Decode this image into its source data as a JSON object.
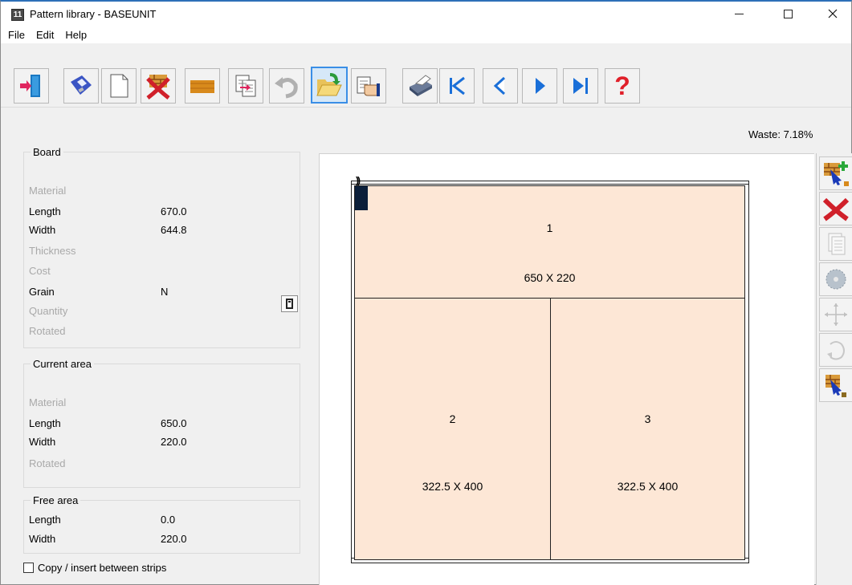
{
  "window": {
    "title": "Pattern library - BASEUNIT",
    "app_icon_text": "11"
  },
  "menu": [
    "File",
    "Edit",
    "Help"
  ],
  "toolbar": {
    "buttons": [
      "exit-icon",
      "save-icon",
      "new-page-icon",
      "delete-pattern-icon",
      "board-icon",
      "copy-pattern-icon",
      "undo-icon",
      "open-folder-icon",
      "hand-pointer-icon",
      "print-icon",
      "first-record-icon",
      "previous-record-icon",
      "next-record-icon",
      "last-record-icon",
      "help-icon"
    ]
  },
  "waste": "Waste: 7.18%",
  "board": {
    "title": "Board",
    "material_label": "Material",
    "length_label": "Length",
    "length_value": "670.0",
    "width_label": "Width",
    "width_value": "644.8",
    "thickness_label": "Thickness",
    "cost_label": "Cost",
    "grain_label": "Grain",
    "grain_value": "N",
    "quantity_label": "Quantity",
    "rotated_label": "Rotated"
  },
  "current_area": {
    "title": "Current area",
    "material_label": "Material",
    "length_label": "Length",
    "length_value": "650.0",
    "width_label": "Width",
    "width_value": "220.0",
    "rotated_label": "Rotated"
  },
  "free_area": {
    "title": "Free area",
    "length_label": "Length",
    "length_value": "0.0",
    "width_label": "Width",
    "width_value": "220.0"
  },
  "copy_insert_label": "Copy / insert between strips",
  "grain_marker": "))",
  "parts": [
    {
      "num": "1",
      "dims": "650 X 220"
    },
    {
      "num": "2",
      "dims": "322.5 X 400"
    },
    {
      "num": "3",
      "dims": "322.5 X 400"
    }
  ],
  "colors": {
    "part_fill": "#fde7d6",
    "accent_blue": "#3a8ee6"
  },
  "right_toolbar": [
    "add-part-icon",
    "delete-part-icon",
    "copy-part-icon",
    "saw-blade-icon",
    "move-icon",
    "rotate-icon",
    "select-part-icon"
  ]
}
